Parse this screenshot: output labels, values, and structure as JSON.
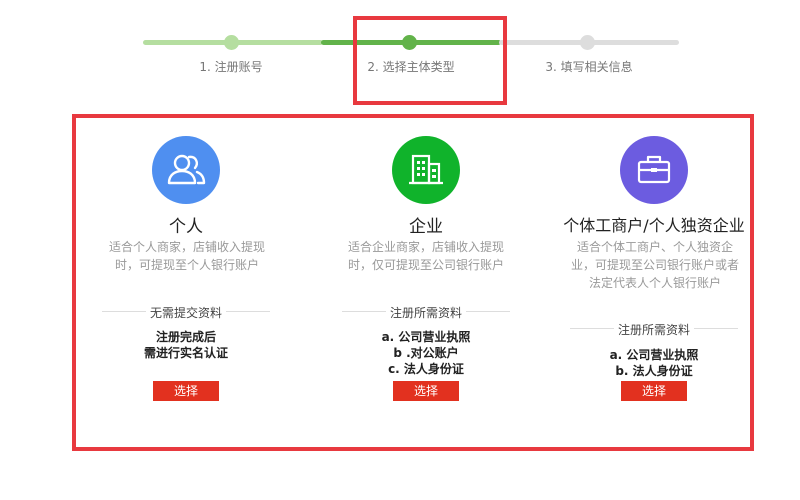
{
  "steps": [
    {
      "label": "1. 注册账号",
      "state": "done"
    },
    {
      "label": "2. 选择主体类型",
      "state": "active"
    },
    {
      "label": "3. 填写相关信息",
      "state": "todo"
    }
  ],
  "colors": {
    "accent_red": "#e2311f",
    "highlight_red": "#e8393f",
    "step_done": "#b5dea0",
    "step_active": "#62b34a",
    "step_todo": "#dddddd",
    "icon_blue": "#4f8ff0",
    "icon_green": "#10b32b",
    "icon_purple": "#6c5ce0"
  },
  "cards": [
    {
      "icon": "users-icon",
      "title": "个人",
      "desc": [
        "适合个人商家，店铺收入提现",
        "时，可提现至个人银行账户"
      ],
      "req_title": "无需提交资料",
      "requirements": [
        "注册完成后",
        "需进行实名认证"
      ],
      "button": "选择"
    },
    {
      "icon": "building-icon",
      "title": "企业",
      "desc": [
        "适合企业商家，店铺收入提现",
        "时，仅可提现至公司银行账户"
      ],
      "req_title": "注册所需资料",
      "requirements": [
        "a. 公司营业执照",
        "b .对公账户",
        "c. 法人身份证"
      ],
      "button": "选择"
    },
    {
      "icon": "briefcase-icon",
      "title": "个体工商户/个人独资企业",
      "desc": [
        "适合个体工商户、个人独资企",
        "业，可提现至公司银行账户或者",
        "法定代表人个人银行账户"
      ],
      "req_title": "注册所需资料",
      "requirements": [
        "a. 公司营业执照",
        "b. 法人身份证"
      ],
      "button": "选择"
    }
  ]
}
